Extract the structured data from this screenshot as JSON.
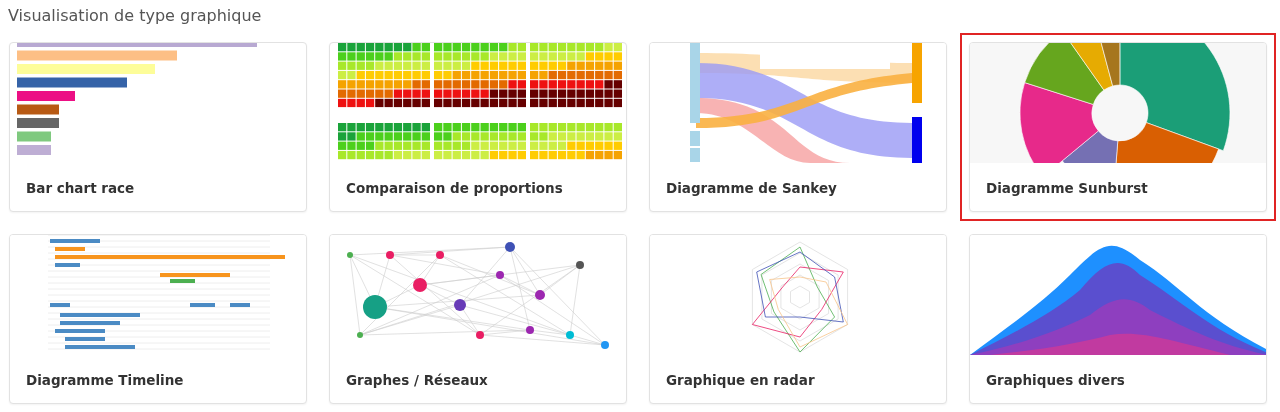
{
  "heading": "Visualisation de type graphique",
  "cards": [
    {
      "title": "Bar chart race",
      "kind": "bar-race",
      "selected": false
    },
    {
      "title": "Comparaison de proportions",
      "kind": "waffle",
      "selected": false
    },
    {
      "title": "Diagramme de Sankey",
      "kind": "sankey",
      "selected": false
    },
    {
      "title": "Diagramme Sunburst",
      "kind": "sunburst",
      "selected": true
    },
    {
      "title": "Diagramme Timeline",
      "kind": "timeline",
      "selected": false
    },
    {
      "title": "Graphes / Réseaux",
      "kind": "network",
      "selected": false
    },
    {
      "title": "Graphique en radar",
      "kind": "radar",
      "selected": false
    },
    {
      "title": "Graphiques divers",
      "kind": "stream",
      "selected": false
    }
  ]
}
